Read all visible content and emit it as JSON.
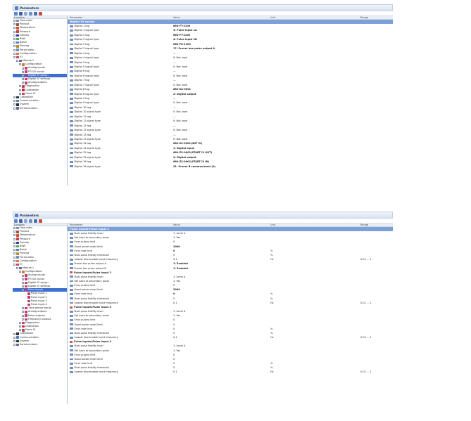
{
  "colors": {
    "accent": "#3c6fd0",
    "section": "#7ca0d9",
    "titlebar": "#dde6f3"
  },
  "win1": {
    "title": "Parameters",
    "tree_header": "Location",
    "cols": {
      "param": "Parameter",
      "value": "Value",
      "unit": "Unit",
      "range": "Range"
    },
    "tree": [
      {
        "label": "Flow rates",
        "indent": 1,
        "icon": "flow-rates-icon",
        "color": "#6a8fd0"
      },
      {
        "label": "Product",
        "indent": 1,
        "icon": "product-icon",
        "color": "#9a5a2a"
      },
      {
        "label": "Temperature",
        "indent": 1,
        "icon": "temperature-icon",
        "color": "#d04a4a"
      },
      {
        "label": "Pressure",
        "indent": 1,
        "icon": "pressure-icon",
        "color": "#c04040"
      },
      {
        "label": "Density",
        "indent": 1,
        "icon": "density-icon",
        "color": "#3a3a9a"
      },
      {
        "label": "BSW",
        "indent": 1,
        "icon": "bsw-icon",
        "color": "#5aa060"
      },
      {
        "label": "Batch",
        "indent": 1,
        "icon": "batch-icon",
        "color": "#4a7fc0"
      },
      {
        "label": "Proving",
        "indent": 1,
        "icon": "proving-icon",
        "color": "#c08a30"
      },
      {
        "label": "Period data",
        "indent": 1,
        "icon": "period-data-icon",
        "color": "#6a8fd0"
      },
      {
        "label": "Configuration",
        "indent": 1,
        "icon": "configuration-icon",
        "color": "#d07a30"
      },
      {
        "label": "IO",
        "indent": 1,
        "icon": "io-icon",
        "color": "#c04070"
      },
      {
        "label": "Module 1",
        "indent": 2,
        "icon": "module-icon",
        "color": "#5a6a8a"
      },
      {
        "label": "Configuration",
        "indent": 3,
        "icon": "configuration-icon",
        "color": "#d07a30"
      },
      {
        "label": "Analog inputs",
        "indent": 4,
        "icon": "analog-inputs-icon",
        "color": "#c04070"
      },
      {
        "label": "PT100 inputs",
        "indent": 4,
        "icon": "pt100-inputs-icon",
        "color": "#c04070"
      },
      {
        "label": "Digital IO assign",
        "indent": 4,
        "icon": "digital-io-assign-icon",
        "color": "#c04070",
        "selected": true
      },
      {
        "label": "Digital IO settings",
        "indent": 4,
        "icon": "digital-io-settings-icon",
        "color": "#c04070"
      },
      {
        "label": "Analog outputs",
        "indent": 4,
        "icon": "analog-outputs-icon",
        "color": "#c04070"
      },
      {
        "label": "Diagnostics",
        "indent": 3,
        "icon": "diagnostics-icon",
        "color": "#c04070"
      },
      {
        "label": "Calibration",
        "indent": 3,
        "icon": "calibration-icon",
        "color": "#c03030"
      },
      {
        "label": "Force IO",
        "indent": 3,
        "icon": "force-io-icon",
        "color": "#c04070"
      },
      {
        "label": "Calibration",
        "indent": 1,
        "icon": "calibration-icon",
        "color": "#303030"
      },
      {
        "label": "Communication",
        "indent": 1,
        "icon": "communication-icon",
        "color": "#4a7fc0"
      },
      {
        "label": "System",
        "indent": 1,
        "icon": "system-icon",
        "color": "#303030"
      },
      {
        "label": "Serialnumbers",
        "indent": 1,
        "icon": "serialnumbers-icon",
        "color": "#5a6a8a"
      }
    ],
    "section": "Digital IO assign",
    "rows": [
      {
        "p": "Digital 1 tag",
        "v": "664-FT-2100",
        "b": true
      },
      {
        "p": "Digital 1 signal type",
        "v": "3: Pulse input 1A",
        "b": true
      },
      {
        "p": "Digital 2 tag",
        "v": "664-FT-2100",
        "b": true
      },
      {
        "p": "Digital 2 signal type",
        "v": "4: Pulse input 1B",
        "b": true
      },
      {
        "p": "Digital 3 tag",
        "v": "664-FK-2100",
        "b": true
      },
      {
        "p": "Digital 3 signal type",
        "v": "17: Prover bus pulse output A",
        "b": true
      },
      {
        "p": "Digital 4 tag",
        "v": "---",
        "b": false
      },
      {
        "p": "Digital 4 signal type",
        "v": "0: Not used",
        "b": false
      },
      {
        "p": "Digital 5 tag",
        "v": "---",
        "b": false
      },
      {
        "p": "Digital 5 signal type",
        "v": "0: Not used",
        "b": false
      },
      {
        "p": "Digital 6 tag",
        "v": "---",
        "b": false
      },
      {
        "p": "Digital 6 signal type",
        "v": "0: Not used",
        "b": false
      },
      {
        "p": "Digital 7 tag",
        "v": "---",
        "b": false
      },
      {
        "p": "Digital 7 signal type",
        "v": "0: Not used",
        "b": false
      },
      {
        "p": "Digital 8 tag",
        "v": "664-XA-0001",
        "b": true
      },
      {
        "p": "Digital 8 signal type",
        "v": "2: Digital output",
        "b": true
      },
      {
        "p": "Digital 9 tag",
        "v": "---",
        "b": false
      },
      {
        "p": "Digital 9 signal type",
        "v": "0: Not used",
        "b": false
      },
      {
        "p": "Digital 10 tag",
        "v": "---",
        "b": false
      },
      {
        "p": "Digital 10 signal type",
        "v": "0: Not used",
        "b": false
      },
      {
        "p": "Digital 11 tag",
        "v": "---",
        "b": false
      },
      {
        "p": "Digital 11 signal type",
        "v": "0: Not used",
        "b": false
      },
      {
        "p": "Digital 12 tag",
        "v": "---",
        "b": false
      },
      {
        "p": "Digital 12 signal type",
        "v": "0: Not used",
        "b": false
      },
      {
        "p": "Digital 13 tag",
        "v": "---",
        "b": false
      },
      {
        "p": "Digital 13 signal type",
        "v": "0: Not used",
        "b": false
      },
      {
        "p": "Digital 14 tag",
        "v": "664-XS-0001(INIT IV)",
        "b": true
      },
      {
        "p": "Digital 14 signal type",
        "v": "1: Digital input",
        "b": true
      },
      {
        "p": "Digital 15 tag",
        "v": "664-ZS-0001(START IV OUT)",
        "b": true
      },
      {
        "p": "Digital 15 signal type",
        "v": "2: Digital output",
        "b": true
      },
      {
        "p": "Digital 16 tag",
        "v": "664-ZS-0001(START IV IN)",
        "b": true
      },
      {
        "p": "Digital 16 signal type",
        "v": "21: Prover B common/start (A)",
        "b": true
      }
    ]
  },
  "win2": {
    "title": "Parameters",
    "tree_header": "Location",
    "cols": {
      "param": "Parameter",
      "value": "Value",
      "unit": "Unit",
      "range": "Range"
    },
    "tree": [
      {
        "label": "Flow rates",
        "indent": 1,
        "icon": "flow-rates-icon",
        "color": "#6a8fd0"
      },
      {
        "label": "Product",
        "indent": 1,
        "icon": "product-icon",
        "color": "#9a5a2a"
      },
      {
        "label": "Temperature",
        "indent": 1,
        "icon": "temperature-icon",
        "color": "#d04a4a"
      },
      {
        "label": "Pressure",
        "indent": 1,
        "icon": "pressure-icon",
        "color": "#c04040"
      },
      {
        "label": "Density",
        "indent": 1,
        "icon": "density-icon",
        "color": "#3a3a9a"
      },
      {
        "label": "BSW",
        "indent": 1,
        "icon": "bsw-icon",
        "color": "#5aa060"
      },
      {
        "label": "Batch",
        "indent": 1,
        "icon": "batch-icon",
        "color": "#4a7fc0"
      },
      {
        "label": "Proving",
        "indent": 1,
        "icon": "proving-icon",
        "color": "#c08a30"
      },
      {
        "label": "Period data",
        "indent": 1,
        "icon": "period-data-icon",
        "color": "#6a8fd0"
      },
      {
        "label": "Configuration",
        "indent": 1,
        "icon": "configuration-icon",
        "color": "#d07a30"
      },
      {
        "label": "IO",
        "indent": 1,
        "icon": "io-icon",
        "color": "#c04070"
      },
      {
        "label": "Module 1",
        "indent": 2,
        "icon": "module-icon",
        "color": "#5a6a8a"
      },
      {
        "label": "Configuration",
        "indent": 3,
        "icon": "configuration-icon",
        "color": "#d07a30"
      },
      {
        "label": "Analog inputs",
        "indent": 4,
        "icon": "analog-inputs-icon",
        "color": "#c04070"
      },
      {
        "label": "PT100 inputs",
        "indent": 4,
        "icon": "pt100-inputs-icon",
        "color": "#c04070"
      },
      {
        "label": "Digital IO assign",
        "indent": 4,
        "icon": "digital-io-assign-icon",
        "color": "#c04070"
      },
      {
        "label": "Digital IO settings",
        "indent": 4,
        "icon": "digital-io-settings-icon",
        "color": "#c04070"
      },
      {
        "label": "Pulse inputs",
        "indent": 4,
        "icon": "pulse-inputs-icon",
        "color": "#c04070",
        "selected": true
      },
      {
        "label": "Pulse input 1",
        "indent": 5,
        "icon": "pulse-input-icon",
        "color": "#c04070"
      },
      {
        "label": "Pulse input 2",
        "indent": 5,
        "icon": "pulse-input-icon",
        "color": "#c04070"
      },
      {
        "label": "Pulse input 3",
        "indent": 5,
        "icon": "pulse-input-icon",
        "color": "#c04070"
      },
      {
        "label": "Pulse input 4",
        "indent": 5,
        "icon": "pulse-input-icon",
        "color": "#c04070"
      },
      {
        "label": "Time period inputs",
        "indent": 4,
        "icon": "time-period-inputs-icon",
        "color": "#c04070"
      },
      {
        "label": "Analog outputs",
        "indent": 4,
        "icon": "analog-outputs-icon",
        "color": "#c04070"
      },
      {
        "label": "Pulse outputs",
        "indent": 4,
        "icon": "pulse-outputs-icon",
        "color": "#c04070"
      },
      {
        "label": "Frequency outputs",
        "indent": 4,
        "icon": "frequency-outputs-icon",
        "color": "#c04070"
      },
      {
        "label": "Diagnostics",
        "indent": 3,
        "icon": "diagnostics-icon",
        "color": "#c04070"
      },
      {
        "label": "Calibration",
        "indent": 3,
        "icon": "calibration-icon",
        "color": "#c03030"
      },
      {
        "label": "Force IO",
        "indent": 3,
        "icon": "force-io-icon",
        "color": "#c04070"
      },
      {
        "label": "Calibration",
        "indent": 1,
        "icon": "calibration-icon",
        "color": "#303030"
      },
      {
        "label": "Communication",
        "indent": 1,
        "icon": "communication-icon",
        "color": "#4a7fc0"
      },
      {
        "label": "System",
        "indent": 1,
        "icon": "system-icon",
        "color": "#303030"
      },
      {
        "label": "Serialnumbers",
        "indent": 1,
        "icon": "serialnumbers-icon",
        "color": "#5a6a8a"
      }
    ],
    "sections": [
      {
        "title": "Pulse inputs\\Pulse input 1",
        "highlight": true,
        "rows": [
          {
            "p": "Dual pulse fidelity level",
            "v": "1: Level A",
            "u": "",
            "r": ""
          },
          {
            "p": "Fall back to secondary pulse",
            "v": "1: Yes",
            "u": "",
            "r": ""
          },
          {
            "p": "Error pulses limit",
            "v": "0",
            "u": "",
            "r": ""
          },
          {
            "p": "Good pulses reset limit",
            "v": "2000",
            "u": "",
            "r": "",
            "b": true
          },
          {
            "p": "Error rate limit",
            "v": "0",
            "u": "%",
            "r": "",
            "b": true
          },
          {
            "p": "Dual pulse fidelity threshold",
            "v": "5",
            "u": "%",
            "r": ""
          },
          {
            "p": "Lowest discernable input frequency",
            "v": "0.1",
            "u": "Hz",
            "r": "0.01 ... 1"
          },
          {
            "p": "Prover bus pulse output A",
            "v": "1: Enabled",
            "u": "",
            "r": "",
            "b": true
          },
          {
            "p": "Prover bus pulse output B",
            "v": "1: Enabled",
            "u": "",
            "r": "",
            "b": true
          }
        ]
      },
      {
        "title": "Pulse inputs\\Pulse input 2",
        "highlight": false,
        "rows": [
          {
            "p": "Dual pulse fidelity level",
            "v": "1: Level A",
            "u": "",
            "r": ""
          },
          {
            "p": "Fall back to secondary pulse",
            "v": "1: Yes",
            "u": "",
            "r": ""
          },
          {
            "p": "Error pulses limit",
            "v": "0",
            "u": "",
            "r": ""
          },
          {
            "p": "Good pulses reset limit",
            "v": "2000",
            "u": "",
            "r": "",
            "b": true
          },
          {
            "p": "Error rate limit",
            "v": "0",
            "u": "%",
            "r": "",
            "b": true
          },
          {
            "p": "Dual pulse fidelity threshold",
            "v": "5",
            "u": "%",
            "r": ""
          },
          {
            "p": "Lowest discernable input frequency",
            "v": "0.1",
            "u": "Hz",
            "r": "0.01 ... 1"
          }
        ]
      },
      {
        "title": "Pulse inputs\\Pulse input 3",
        "highlight": false,
        "rows": [
          {
            "p": "Dual pulse fidelity level",
            "v": "1: Level A",
            "u": "",
            "r": ""
          },
          {
            "p": "Fall back to secondary pulse",
            "v": "1: Yes",
            "u": "",
            "r": ""
          },
          {
            "p": "Error pulses limit",
            "v": "0",
            "u": "",
            "r": ""
          },
          {
            "p": "Good pulses reset limit",
            "v": "0",
            "u": "",
            "r": ""
          },
          {
            "p": "Error rate limit",
            "v": "0",
            "u": "%",
            "r": ""
          },
          {
            "p": "Dual pulse fidelity threshold",
            "v": "5",
            "u": "%",
            "r": ""
          },
          {
            "p": "Lowest discernable input frequency",
            "v": "0.1",
            "u": "Hz",
            "r": "0.01 ... 1"
          }
        ]
      },
      {
        "title": "Pulse inputs\\Pulse input 4",
        "highlight": false,
        "rows": [
          {
            "p": "Dual pulse fidelity level",
            "v": "1: Level A",
            "u": "",
            "r": ""
          },
          {
            "p": "Fall back to secondary pulse",
            "v": "1: Yes",
            "u": "",
            "r": ""
          },
          {
            "p": "Error pulses limit",
            "v": "0",
            "u": "",
            "r": ""
          },
          {
            "p": "Good pulses reset limit",
            "v": "0",
            "u": "",
            "r": ""
          },
          {
            "p": "Error rate limit",
            "v": "0",
            "u": "%",
            "r": ""
          },
          {
            "p": "Dual pulse fidelity threshold",
            "v": "5",
            "u": "%",
            "r": ""
          },
          {
            "p": "Lowest discernable input frequency",
            "v": "0.1",
            "u": "Hz",
            "r": "0.01 ... 1"
          }
        ]
      }
    ]
  }
}
